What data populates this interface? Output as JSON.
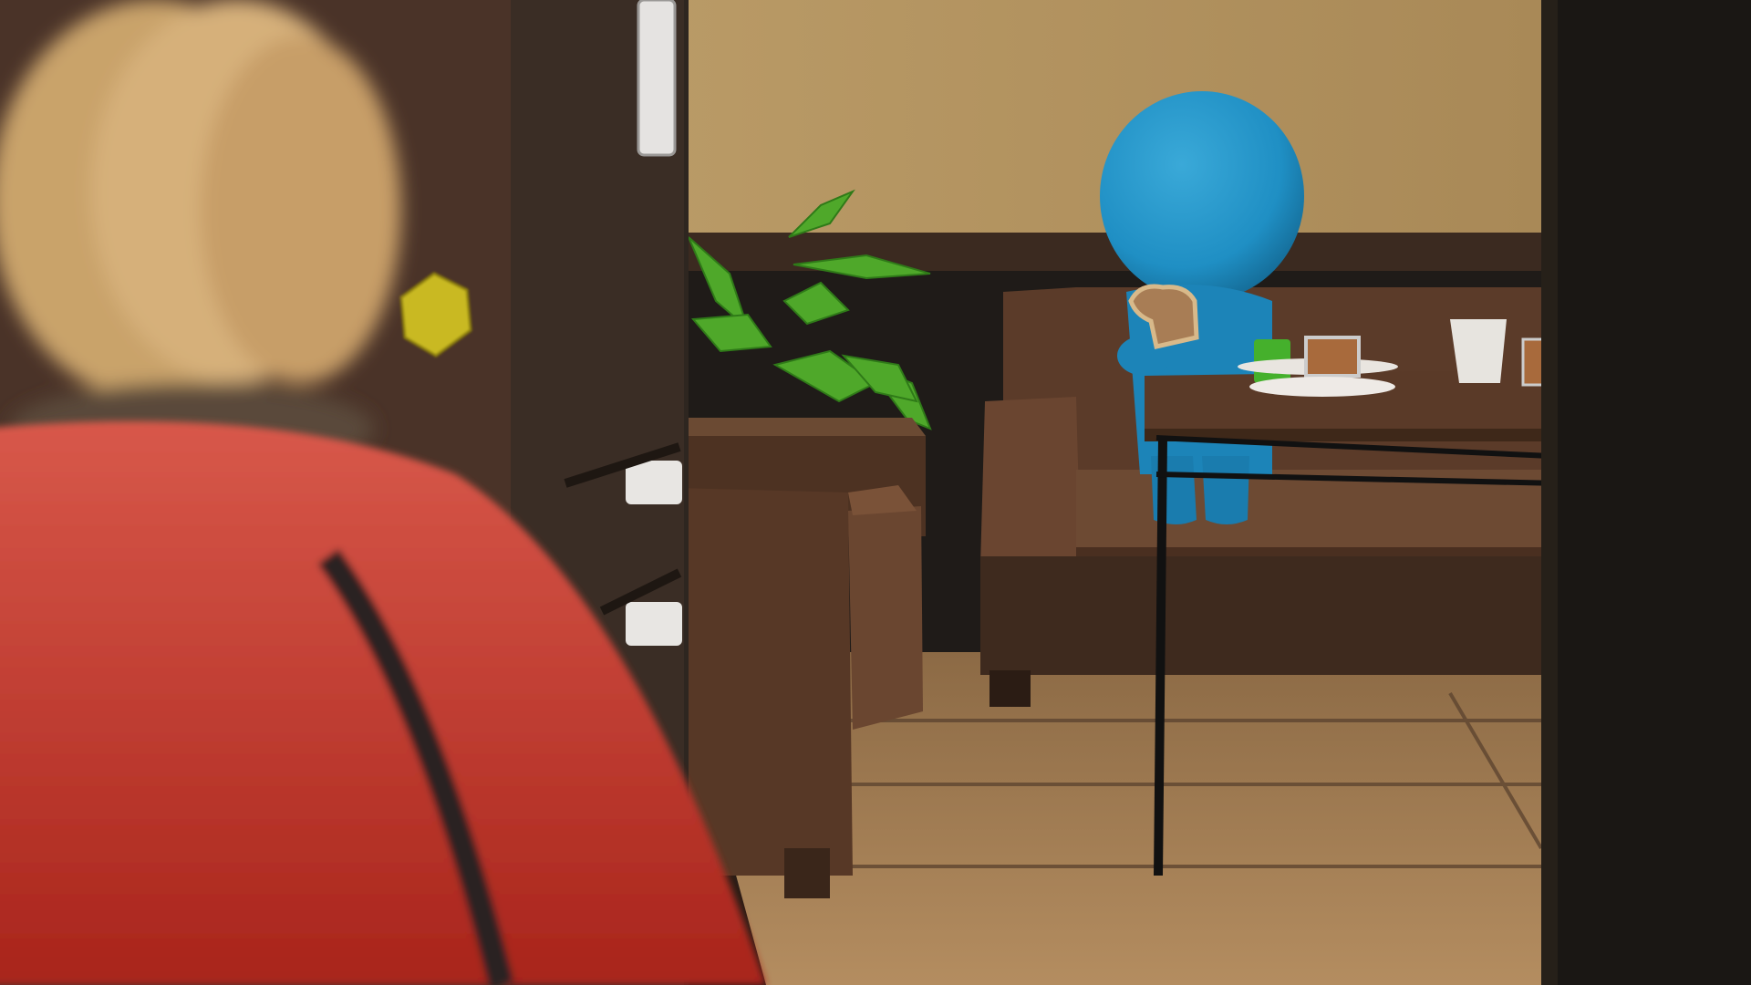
{
  "scene": {
    "colors": {
      "wall_upper": "#b08f5e",
      "wall_band": "#2b1f18",
      "floor": "#a07b52",
      "sofa": "#5a3a28",
      "character": "#1f8fc4",
      "plant": "#4aa02a",
      "toaster": "#c23a2e",
      "bread": "#d8b071",
      "gem": "#c9b920",
      "fridge": "#3a2a22",
      "door_frame": "#1b1714"
    },
    "objects": [
      "blue-character",
      "toast-slice",
      "sofa",
      "dining-table",
      "potted-plant",
      "refrigerator",
      "red-toaster",
      "bread-loaf",
      "yellow-gem",
      "cups-and-plates"
    ]
  }
}
